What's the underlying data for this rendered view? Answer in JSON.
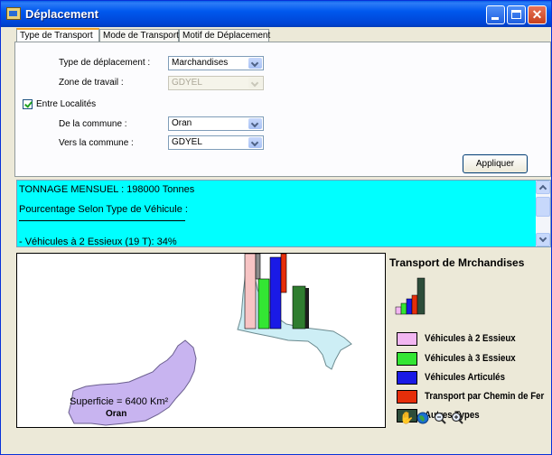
{
  "window": {
    "title": "Déplacement"
  },
  "tabs": [
    {
      "label": "Type de Transport",
      "active": true
    },
    {
      "label": "Mode de Transport",
      "active": false
    },
    {
      "label": "Motif de Déplacement",
      "active": false
    }
  ],
  "form": {
    "type_deplacement": {
      "label": "Type de déplacement :",
      "value": "Marchandises"
    },
    "zone_travail": {
      "label": "Zone de travail :",
      "value": "GDYEL",
      "disabled": true
    },
    "entre_localites": {
      "label": "Entre Localités",
      "checked": true
    },
    "de_commune": {
      "label": "De la commune :",
      "value": "Oran"
    },
    "vers_commune": {
      "label": "Vers la commune :",
      "value": "GDYEL"
    },
    "apply_label": "Appliquer"
  },
  "info": {
    "line1": "TONNAGE MENSUEL : 198000 Tonnes",
    "line2": "Pourcentage Selon Type de Véhicule :",
    "line3": "- Véhicules à 2 Essieux (19 T): 34%",
    "background": "#00ffff"
  },
  "map": {
    "superficie_label": "Superficie = 6400 Km²",
    "region_label": "Oran",
    "oran_color": "#c8b4f0",
    "gdyel_color": "#cdeef5"
  },
  "legend": {
    "title": "Transport de Mrchandises",
    "items": [
      {
        "label": "Véhicules à 2 Essieux",
        "color": "#f2b6f2"
      },
      {
        "label": "Véhicules à 3 Essieux",
        "color": "#33e633"
      },
      {
        "label": "Véhicules Articulés",
        "color": "#1a1ae6"
      },
      {
        "label": "Transport par Chemin de Fer",
        "color": "#e62e0a"
      },
      {
        "label": "Autres Types",
        "color": "#2d4d3a"
      }
    ]
  },
  "toolbar_icons": [
    "pan-hand-icon",
    "globe-icon",
    "zoom-out-icon",
    "zoom-in-icon"
  ]
}
